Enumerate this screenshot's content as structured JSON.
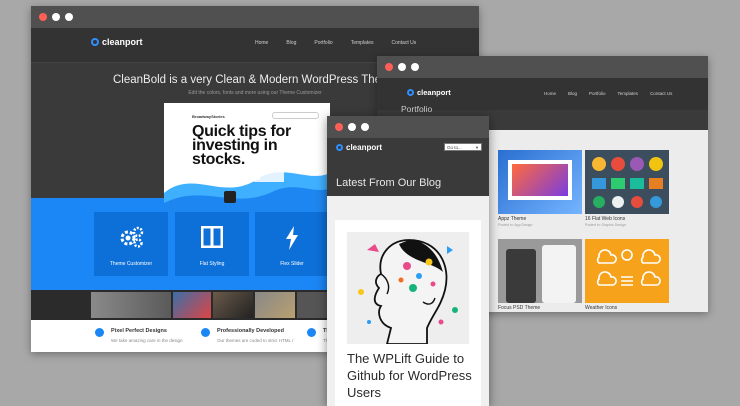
{
  "dot_colors": {
    "close": "#ff5f57",
    "min": "#ffffff",
    "max": "#ffffff"
  },
  "accent": "#1b86f5",
  "window_main": {
    "logo": "cleanport",
    "nav": [
      "Home",
      "Blog",
      "Portfolio",
      "Templates",
      "Contact Us"
    ],
    "hero_title": "CleanBold is a very Clean & Modern WordPress Theme",
    "hero_subtitle": "Edit the colors, fonts and more using our Theme Customizer",
    "tablet_brand": "BroadwayStories",
    "tablet_headline": "Quick tips for investing in stocks.",
    "features": [
      {
        "label": "Theme Customizer",
        "icon": "gears-icon"
      },
      {
        "label": "Flat Styling",
        "icon": "columns-icon"
      },
      {
        "label": "Flex Slider",
        "icon": "lightning-icon"
      }
    ],
    "bottom_points": [
      {
        "title": "Pixel Perfect Designs",
        "desc": "We take amazing care in the design"
      },
      {
        "title": "Professionally Developed",
        "desc": "Our themes are coded to strict HTML /"
      },
      {
        "title": "Th",
        "desc": "Th"
      }
    ]
  },
  "window_portfolio": {
    "logo": "cleanport",
    "nav": [
      "Home",
      "Blog",
      "Portfolio",
      "Templates",
      "Contact Us"
    ],
    "section_title": "Portfolio",
    "items": [
      {
        "caption": "Appz Theme",
        "meta": "Posted in: App Design"
      },
      {
        "caption": "16 Flat Web Icons",
        "meta": "Posted in: Graphic Design"
      },
      {
        "caption": "Focus PSD Theme",
        "meta": ""
      },
      {
        "caption": "Weather Icons",
        "meta": ""
      }
    ]
  },
  "window_blog": {
    "logo": "cleanport",
    "goto_placeholder": "Go to...",
    "section_title": "Latest From Our Blog",
    "post_title": "The WPLift Guide to Github for WordPress Users"
  }
}
